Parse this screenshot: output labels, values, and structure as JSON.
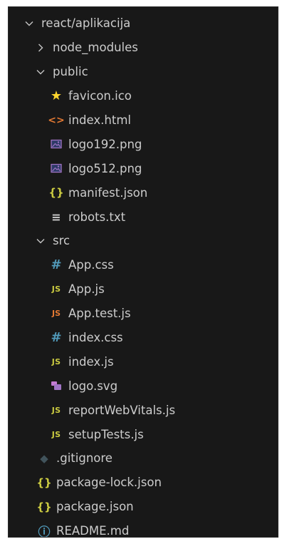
{
  "explorer": {
    "items": [
      {
        "label": "react/aplikacija",
        "kind": "folder",
        "expanded": true,
        "depth": 0
      },
      {
        "label": "node_modules",
        "kind": "folder",
        "expanded": false,
        "depth": 1
      },
      {
        "label": "public",
        "kind": "folder",
        "expanded": true,
        "depth": 1
      },
      {
        "label": "favicon.ico",
        "kind": "file",
        "icon": "star-icon",
        "depth": 2
      },
      {
        "label": "index.html",
        "kind": "file",
        "icon": "html-icon",
        "depth": 2
      },
      {
        "label": "logo192.png",
        "kind": "file",
        "icon": "image-icon",
        "depth": 2
      },
      {
        "label": "logo512.png",
        "kind": "file",
        "icon": "image-icon",
        "depth": 2
      },
      {
        "label": "manifest.json",
        "kind": "file",
        "icon": "json-icon",
        "depth": 2
      },
      {
        "label": "robots.txt",
        "kind": "file",
        "icon": "text-icon",
        "depth": 2
      },
      {
        "label": "src",
        "kind": "folder",
        "expanded": true,
        "depth": 1
      },
      {
        "label": "App.css",
        "kind": "file",
        "icon": "css-icon",
        "depth": 2
      },
      {
        "label": "App.js",
        "kind": "file",
        "icon": "js-icon",
        "depth": 2
      },
      {
        "label": "App.test.js",
        "kind": "file",
        "icon": "js-test-icon",
        "depth": 2
      },
      {
        "label": "index.css",
        "kind": "file",
        "icon": "css-icon",
        "depth": 2
      },
      {
        "label": "index.js",
        "kind": "file",
        "icon": "js-icon",
        "depth": 2
      },
      {
        "label": "logo.svg",
        "kind": "file",
        "icon": "svg-icon",
        "depth": 2
      },
      {
        "label": "reportWebVitals.js",
        "kind": "file",
        "icon": "js-icon",
        "depth": 2
      },
      {
        "label": "setupTests.js",
        "kind": "file",
        "icon": "js-icon",
        "depth": 2
      },
      {
        "label": ".gitignore",
        "kind": "file",
        "icon": "git-icon",
        "depth": 1
      },
      {
        "label": "package-lock.json",
        "kind": "file",
        "icon": "json-icon",
        "depth": 1
      },
      {
        "label": "package.json",
        "kind": "file",
        "icon": "json-icon",
        "depth": 1
      },
      {
        "label": "README.md",
        "kind": "file",
        "icon": "info-icon",
        "depth": 1
      }
    ]
  },
  "colors": {
    "background": "#181818",
    "text": "#cccccc",
    "js": "#cbcb41",
    "css": "#519aba",
    "html": "#e37933",
    "star": "#ffd52e"
  }
}
